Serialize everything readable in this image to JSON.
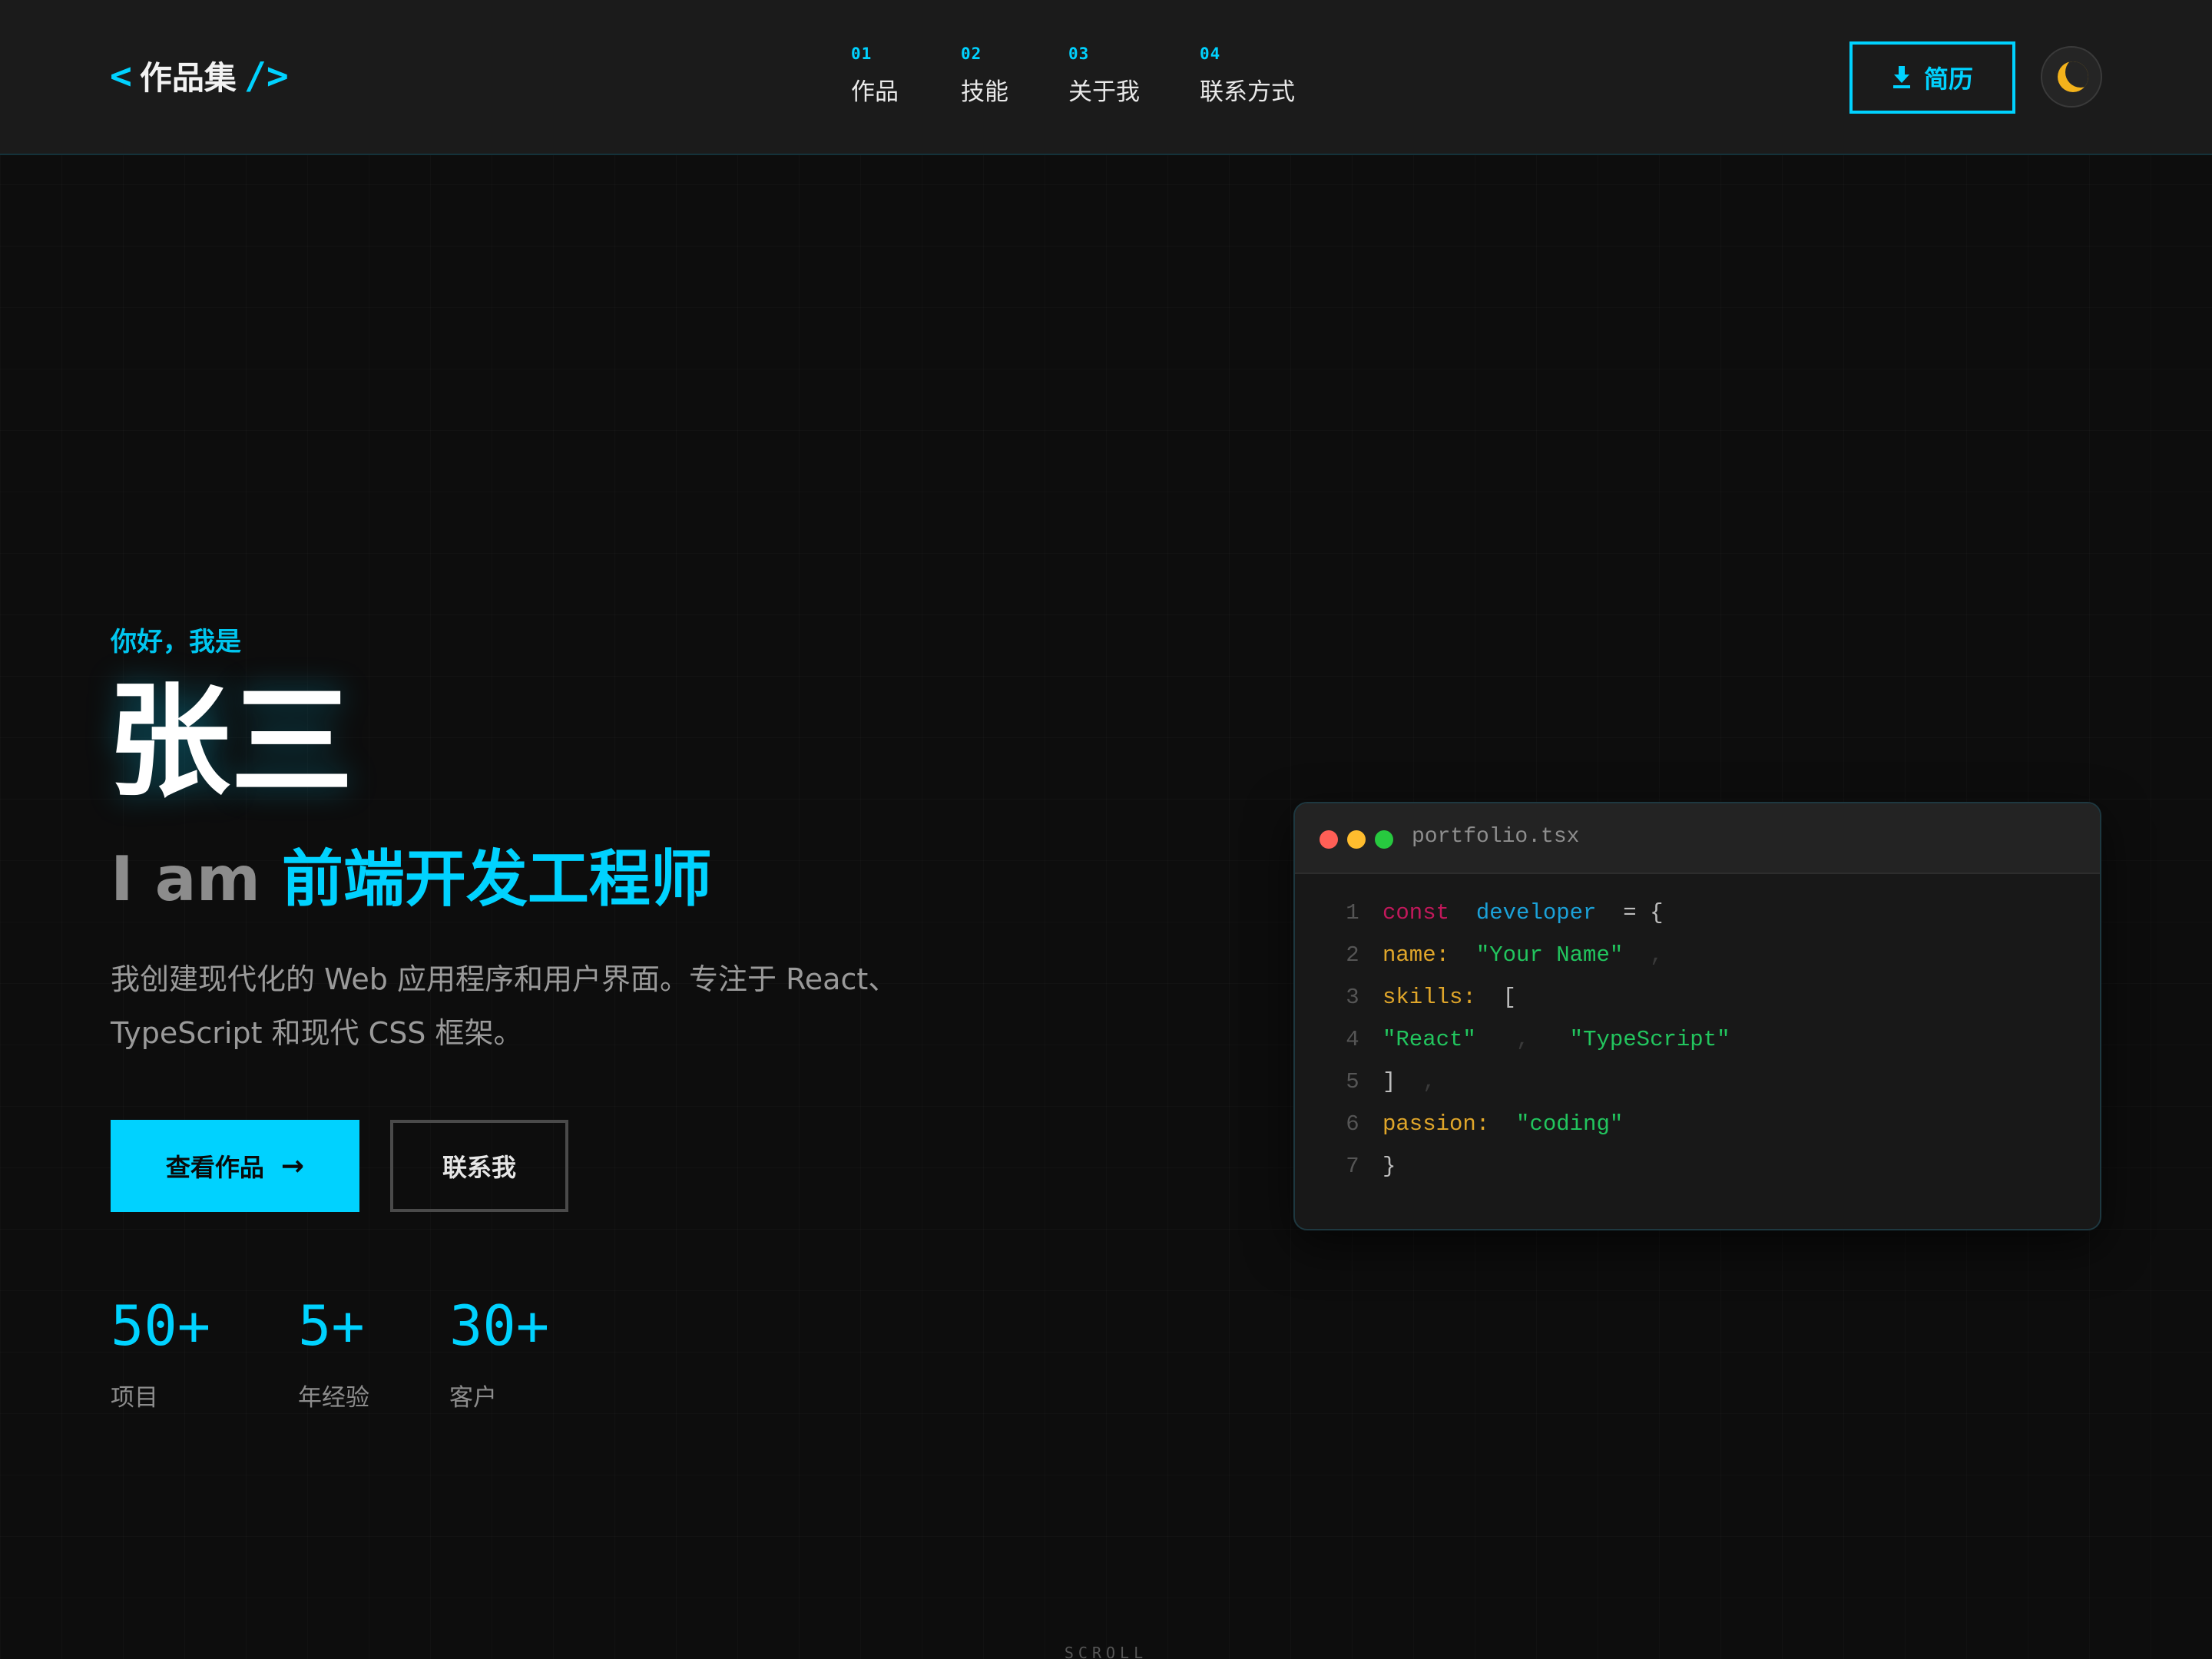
{
  "header": {
    "logo_open": "<",
    "logo_text": "作品集",
    "logo_close": "/>",
    "nav": [
      {
        "num": "01",
        "label": "作品"
      },
      {
        "num": "02",
        "label": "技能"
      },
      {
        "num": "03",
        "label": "关于我"
      },
      {
        "num": "04",
        "label": "联系方式"
      }
    ],
    "resume_label": "简历",
    "resume_icon": "download-icon",
    "theme_icon": "moon-icon"
  },
  "hero": {
    "greeting": "你好，我是",
    "name": "张三",
    "role_prefix": "I am",
    "role_highlight": "前端开发工程师",
    "description": "我创建现代化的 Web 应用程序和用户界面。专注于 React、TypeScript 和现代 CSS 框架。",
    "primary_button": "查看作品",
    "secondary_button": "联系我",
    "stats": [
      {
        "value": "50+",
        "label": "项目"
      },
      {
        "value": "5+",
        "label": "年经验"
      },
      {
        "value": "30+",
        "label": "客户"
      }
    ]
  },
  "code_window": {
    "filename": "portfolio.tsx",
    "lines": [
      {
        "num": "1",
        "kw": "const",
        "var": "developer",
        "op": "= {"
      },
      {
        "num": "2",
        "key": "name:",
        "str": "\"Your Name\"",
        "dim": ","
      },
      {
        "num": "3",
        "key": "skills:",
        "op": "["
      },
      {
        "num": "4",
        "str1": "\"React\"",
        "dim": ",",
        "str2": "\"TypeScript\""
      },
      {
        "num": "5",
        "op": "]",
        "dim": ","
      },
      {
        "num": "6",
        "key": "passion:",
        "str": "\"coding\""
      },
      {
        "num": "7",
        "op": "}"
      }
    ]
  },
  "scroll_hint": "SCROLL",
  "colors": {
    "accent": "#00d2ff",
    "background": "#0d0d0d",
    "header": "#1b1b1b"
  }
}
